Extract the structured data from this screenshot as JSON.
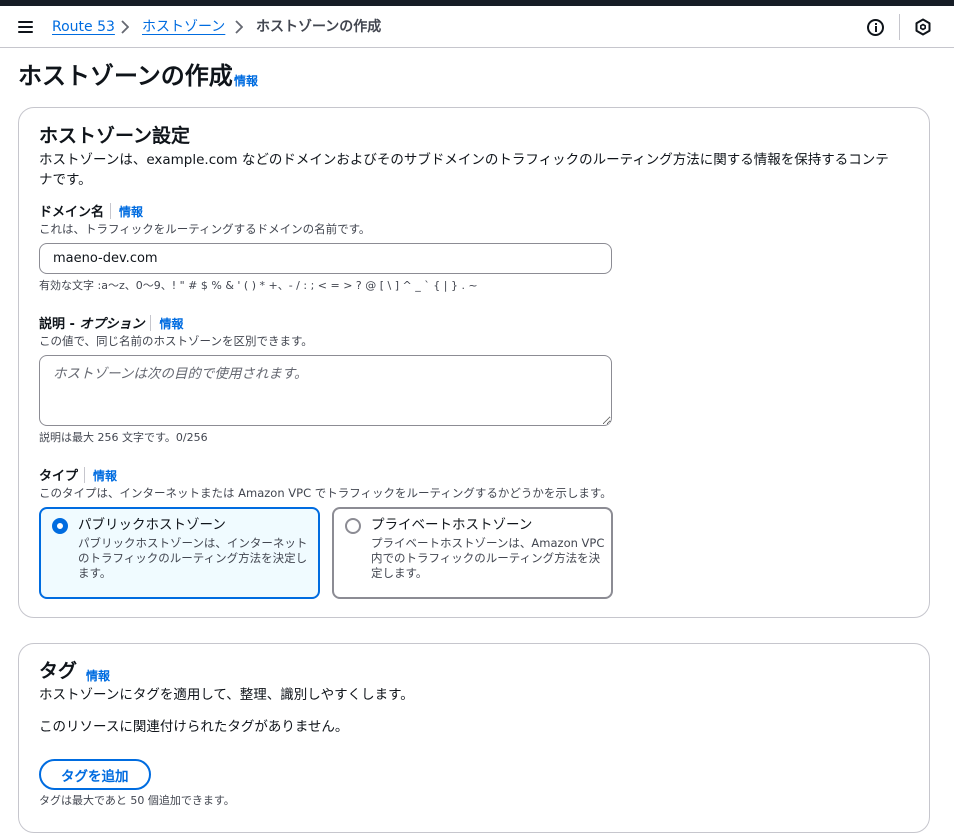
{
  "breadcrumb": {
    "items": [
      "Route 53",
      "ホストゾーン"
    ],
    "current": "ホストゾーンの作成"
  },
  "page": {
    "title": "ホストゾーンの作成",
    "info": "情報"
  },
  "config_panel": {
    "title": "ホストゾーン設定",
    "description_line1": "ホストゾーンは、example.com などのドメインおよびそのサブドメインのトラフィックのルーティング方法に関する情報を保持するコンテ",
    "description_line2": "ナです。",
    "domain": {
      "label": "ドメイン名",
      "info": "情報",
      "description": "これは、トラフィックをルーティングするドメインの名前です。",
      "value": "maeno-dev.com",
      "constraint": "有効な文字 :a〜z、0〜9、! \" # $ % & ' ( ) * +、- / : ; < = > ? @ [ \\ ] ^ _ ` { | } . ~"
    },
    "comment": {
      "label_main": "説明 - ",
      "label_optional": "オプション",
      "info": "情報",
      "description": "この値で、同じ名前のホストゾーンを区別できます。",
      "placeholder": "ホストゾーンは次の目的で使用されます。",
      "constraint": "説明は最大 256 文字です。0/256"
    },
    "type": {
      "label": "タイプ",
      "info": "情報",
      "description": "このタイプは、インターネットまたは Amazon VPC でトラフィックをルーティングするかどうかを示します。",
      "options": [
        {
          "title": "パブリックホストゾーン",
          "description": "パブリックホストゾーンは、インターネットのトラフィックのルーティング方法を決定します。",
          "selected": true
        },
        {
          "title": "プライベートホストゾーン",
          "description": "プライベートホストゾーンは、Amazon VPC 内でのトラフィックのルーティング方法を決定します。",
          "selected": false
        }
      ]
    }
  },
  "tags_panel": {
    "title": "タグ",
    "info": "情報",
    "description": "ホストゾーンにタグを適用して、整理、識別しやすくします。",
    "empty_message": "このリソースに関連付けられたタグがありません。",
    "add_button": "タグを追加",
    "limit_text": "タグは最大であと 50 個追加できます。"
  },
  "colors": {
    "link": "#006ce0",
    "selected_tile_bg": "#f0fbff",
    "border": "#c6c6cd",
    "top_strip": "#161d26"
  },
  "icons": {
    "menu": "hamburger-icon",
    "separator": "chevron-right-icon",
    "help": "info-circle-icon",
    "notifications": "hexagon-icon"
  }
}
